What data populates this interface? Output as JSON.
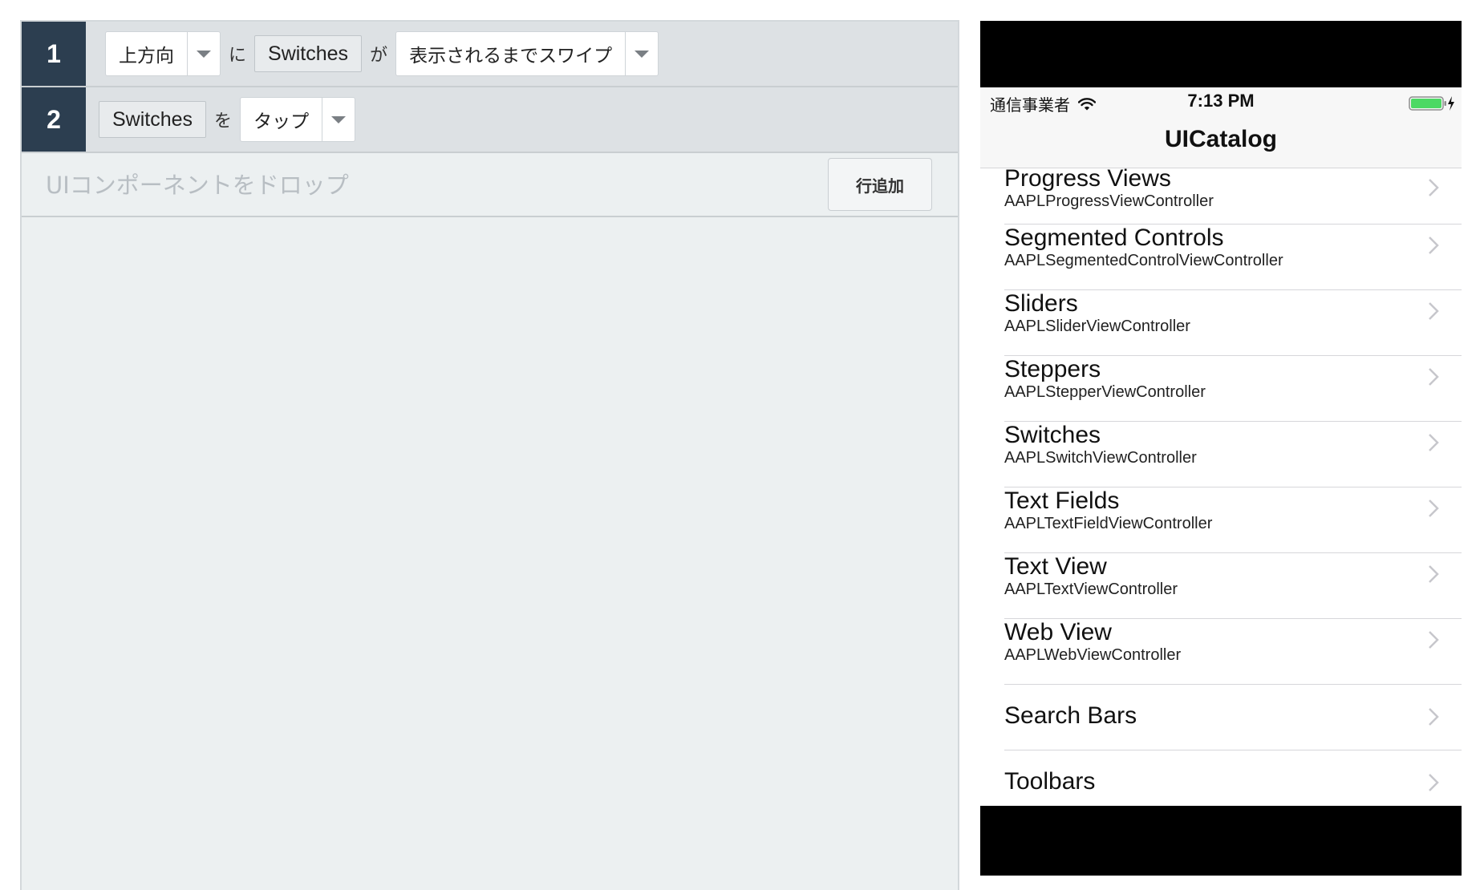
{
  "steps": [
    {
      "number": "1",
      "direction": "上方向",
      "particle1": "に",
      "component": "Switches",
      "particle2": "が",
      "action": "表示されるまでスワイプ"
    },
    {
      "number": "2",
      "component": "Switches",
      "particle": "を",
      "action": "タップ"
    }
  ],
  "dropzone": {
    "placeholder": "UIコンポーネントをドロップ",
    "add_row_label": "行追加"
  },
  "phone": {
    "status": {
      "carrier": "通信事業者",
      "time": "7:13 PM"
    },
    "nav_title": "UICatalog",
    "items": [
      {
        "title": "Progress Views",
        "subtitle": "AAPLProgressViewController"
      },
      {
        "title": "Segmented Controls",
        "subtitle": "AAPLSegmentedControlViewController"
      },
      {
        "title": "Sliders",
        "subtitle": "AAPLSliderViewController"
      },
      {
        "title": "Steppers",
        "subtitle": "AAPLStepperViewController"
      },
      {
        "title": "Switches",
        "subtitle": "AAPLSwitchViewController"
      },
      {
        "title": "Text Fields",
        "subtitle": "AAPLTextFieldViewController"
      },
      {
        "title": "Text View",
        "subtitle": "AAPLTextViewController"
      },
      {
        "title": "Web View",
        "subtitle": "AAPLWebViewController"
      },
      {
        "title": "Search Bars"
      },
      {
        "title": "Toolbars"
      }
    ]
  },
  "colors": {
    "step_number_bg": "#2c3e50",
    "editor_bg": "#ecf0f1",
    "battery": "#4cd964"
  },
  "icons": [
    "caret-down-icon",
    "wifi-icon",
    "battery-icon",
    "charging-bolt-icon",
    "chevron-right-icon"
  ]
}
